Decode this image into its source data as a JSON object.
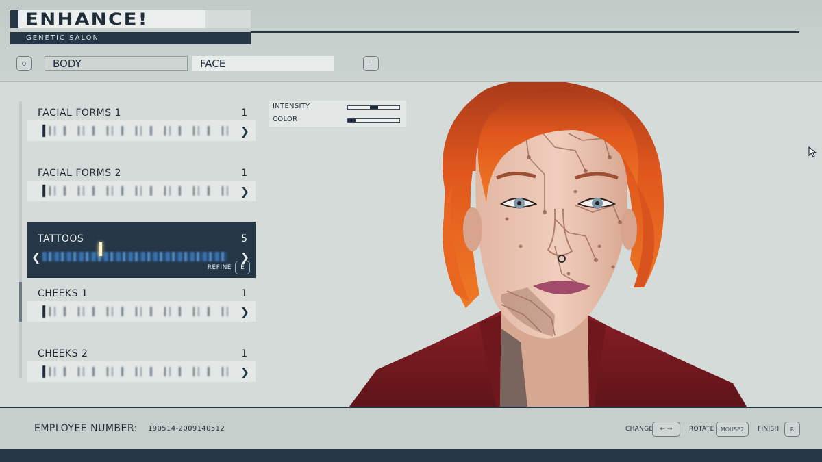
{
  "header": {
    "title": "ENHANCE!",
    "subtitle": "GENETIC SALON",
    "tabs": [
      {
        "label": "BODY",
        "key": "Q",
        "active": false
      },
      {
        "label": "FACE",
        "key": "T",
        "active": true
      }
    ]
  },
  "options": [
    {
      "label": "FACIAL FORMS 1",
      "value": "1",
      "selected": false
    },
    {
      "label": "FACIAL FORMS 2",
      "value": "1",
      "selected": false
    },
    {
      "label": "TATTOOS",
      "value": "5",
      "selected": true,
      "refine_label": "REFINE",
      "refine_key": "E"
    },
    {
      "label": "CHEEKS 1",
      "value": "1",
      "selected": false
    },
    {
      "label": "CHEEKS 2",
      "value": "1",
      "selected": false
    }
  ],
  "sliders": [
    {
      "label": "INTENSITY",
      "level": 0.5
    },
    {
      "label": "COLOR",
      "level": 0.15
    }
  ],
  "footer": {
    "employee_label": "EMPLOYEE NUMBER:",
    "employee_number": "190514-2009140512",
    "hints": [
      {
        "label": "CHANGE",
        "key": "← →"
      },
      {
        "label": "ROTATE",
        "key": "MOUSE2"
      },
      {
        "label": "FINISH",
        "key": "R"
      }
    ]
  },
  "icons": {
    "nav_left": "chevron-left-icon",
    "nav_right": "chevron-right-icon",
    "cursor": "mouse-cursor-icon"
  },
  "colors": {
    "primary_dark": "#253746",
    "panel_light": "#e3e8e7",
    "background": "#d4dbd9",
    "tattoo_bar": "#3c78b8",
    "hair": "#d9531e"
  }
}
